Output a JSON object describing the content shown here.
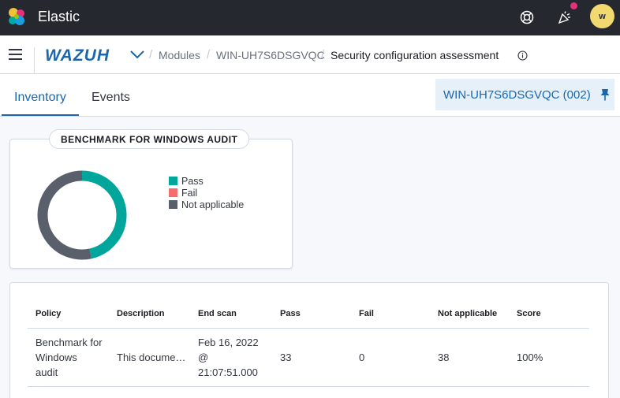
{
  "header": {
    "app_title": "Elastic",
    "avatar_initial": "w",
    "icons": [
      "elastic-logo-icon",
      "help-lifebuoy-icon",
      "news-feed-icon"
    ]
  },
  "breadcrumb": {
    "logo_text": "WAZUH",
    "items": [
      "Modules",
      "WIN-UH7S6DSGVQC"
    ],
    "current": "Security configuration assessment"
  },
  "tabs": {
    "inventory": "Inventory",
    "events": "Events",
    "active": "Inventory"
  },
  "agent": {
    "label": "WIN-UH7S6DSGVQC (002)"
  },
  "chart_card": {
    "title": "BENCHMARK FOR WINDOWS AUDIT"
  },
  "chart_data": {
    "type": "pie",
    "title": "BENCHMARK FOR WINDOWS AUDIT",
    "categories": [
      "Pass",
      "Fail",
      "Not applicable"
    ],
    "values": [
      33,
      0,
      38
    ],
    "colors": [
      "#00a69b",
      "#f66d6d",
      "#5a606b"
    ],
    "legend_position": "right",
    "donut": true
  },
  "table": {
    "headers": [
      "Policy",
      "Description",
      "End scan",
      "Pass",
      "Fail",
      "Not applicable",
      "Score"
    ],
    "rows": [
      {
        "policy": [
          "Benchmark for",
          "Windows",
          "audit"
        ],
        "description": "This docume…",
        "end_scan": [
          "Feb 16, 2022",
          "@",
          "21:07:51.000"
        ],
        "pass": "33",
        "fail": "0",
        "not_applicable": "38",
        "score": "100%"
      }
    ]
  },
  "colors": {
    "header_bg": "#25282f",
    "accent": "#1b67ad",
    "pass": "#00a69b",
    "fail": "#f66d6d",
    "not_applicable": "#5a606b"
  }
}
